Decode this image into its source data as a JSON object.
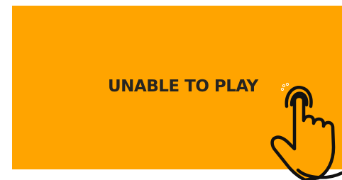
{
  "player": {
    "message": "UNABLE TO PLAY",
    "background_color": "#ffa400",
    "text_color": "#262421"
  },
  "icons": {
    "pointer": "tap-hand-icon"
  }
}
